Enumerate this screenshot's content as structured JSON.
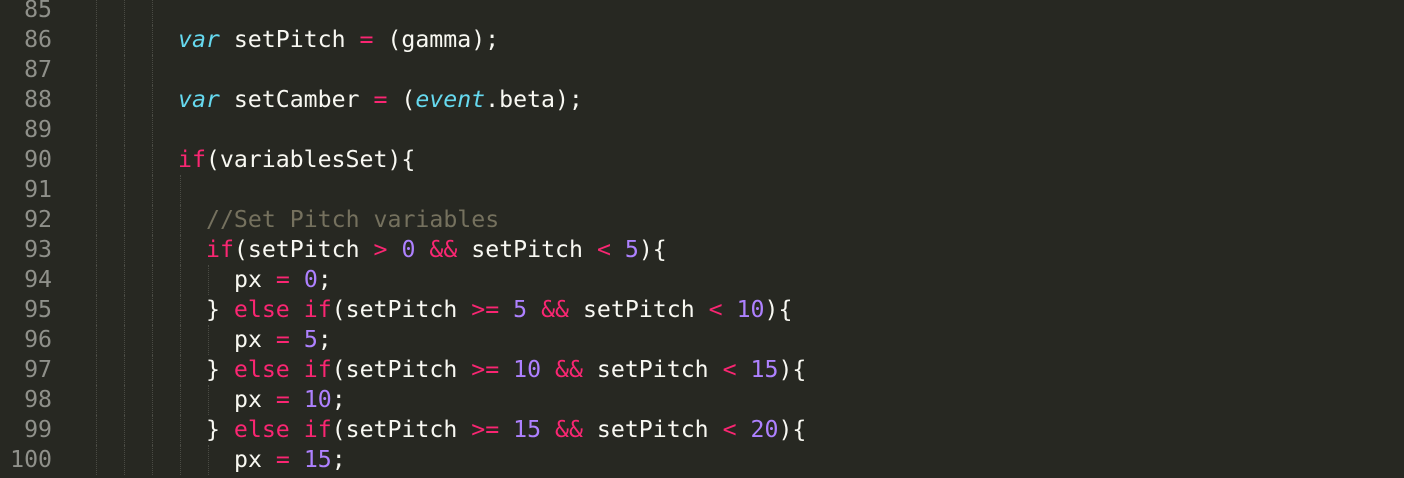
{
  "editor": {
    "theme_colors": {
      "background": "#272822",
      "keyword": "#f92672",
      "number": "#ae81ff",
      "storage": "#66d9ef",
      "comment": "#75715e",
      "text": "#f8f8f2",
      "gutter": "#8f908a"
    },
    "lines": [
      {
        "n": "85",
        "indent": 0,
        "tokens": []
      },
      {
        "n": "86",
        "indent": 0,
        "tokens": [
          [
            "storage",
            "var"
          ],
          [
            "plain",
            " setPitch "
          ],
          [
            "op",
            "="
          ],
          [
            "plain",
            " (gamma);"
          ]
        ]
      },
      {
        "n": "87",
        "indent": 0,
        "tokens": []
      },
      {
        "n": "88",
        "indent": 0,
        "tokens": [
          [
            "storage",
            "var"
          ],
          [
            "plain",
            " setCamber "
          ],
          [
            "op",
            "="
          ],
          [
            "plain",
            " ("
          ],
          [
            "storage",
            "event"
          ],
          [
            "plain",
            ".beta);"
          ]
        ]
      },
      {
        "n": "89",
        "indent": 0,
        "tokens": []
      },
      {
        "n": "90",
        "indent": 0,
        "tokens": [
          [
            "kw",
            "if"
          ],
          [
            "plain",
            "(variablesSet){"
          ]
        ]
      },
      {
        "n": "91",
        "indent": 1,
        "tokens": []
      },
      {
        "n": "92",
        "indent": 1,
        "tokens": [
          [
            "comment",
            "//Set Pitch variables"
          ]
        ]
      },
      {
        "n": "93",
        "indent": 1,
        "tokens": [
          [
            "kw",
            "if"
          ],
          [
            "plain",
            "(setPitch "
          ],
          [
            "op",
            ">"
          ],
          [
            "plain",
            " "
          ],
          [
            "num",
            "0"
          ],
          [
            "plain",
            " "
          ],
          [
            "op",
            "&&"
          ],
          [
            "plain",
            " setPitch "
          ],
          [
            "op",
            "<"
          ],
          [
            "plain",
            " "
          ],
          [
            "num",
            "5"
          ],
          [
            "plain",
            "){"
          ]
        ]
      },
      {
        "n": "94",
        "indent": 2,
        "tokens": [
          [
            "plain",
            "px "
          ],
          [
            "op",
            "="
          ],
          [
            "plain",
            " "
          ],
          [
            "num",
            "0"
          ],
          [
            "plain",
            ";"
          ]
        ]
      },
      {
        "n": "95",
        "indent": 1,
        "tokens": [
          [
            "plain",
            "} "
          ],
          [
            "kw",
            "else"
          ],
          [
            "plain",
            " "
          ],
          [
            "kw",
            "if"
          ],
          [
            "plain",
            "(setPitch "
          ],
          [
            "op",
            ">="
          ],
          [
            "plain",
            " "
          ],
          [
            "num",
            "5"
          ],
          [
            "plain",
            " "
          ],
          [
            "op",
            "&&"
          ],
          [
            "plain",
            " setPitch "
          ],
          [
            "op",
            "<"
          ],
          [
            "plain",
            " "
          ],
          [
            "num",
            "10"
          ],
          [
            "plain",
            "){"
          ]
        ]
      },
      {
        "n": "96",
        "indent": 2,
        "tokens": [
          [
            "plain",
            "px "
          ],
          [
            "op",
            "="
          ],
          [
            "plain",
            " "
          ],
          [
            "num",
            "5"
          ],
          [
            "plain",
            ";"
          ]
        ]
      },
      {
        "n": "97",
        "indent": 1,
        "tokens": [
          [
            "plain",
            "} "
          ],
          [
            "kw",
            "else"
          ],
          [
            "plain",
            " "
          ],
          [
            "kw",
            "if"
          ],
          [
            "plain",
            "(setPitch "
          ],
          [
            "op",
            ">="
          ],
          [
            "plain",
            " "
          ],
          [
            "num",
            "10"
          ],
          [
            "plain",
            " "
          ],
          [
            "op",
            "&&"
          ],
          [
            "plain",
            " setPitch "
          ],
          [
            "op",
            "<"
          ],
          [
            "plain",
            " "
          ],
          [
            "num",
            "15"
          ],
          [
            "plain",
            "){"
          ]
        ]
      },
      {
        "n": "98",
        "indent": 2,
        "tokens": [
          [
            "plain",
            "px "
          ],
          [
            "op",
            "="
          ],
          [
            "plain",
            " "
          ],
          [
            "num",
            "10"
          ],
          [
            "plain",
            ";"
          ]
        ]
      },
      {
        "n": "99",
        "indent": 1,
        "tokens": [
          [
            "plain",
            "} "
          ],
          [
            "kw",
            "else"
          ],
          [
            "plain",
            " "
          ],
          [
            "kw",
            "if"
          ],
          [
            "plain",
            "(setPitch "
          ],
          [
            "op",
            ">="
          ],
          [
            "plain",
            " "
          ],
          [
            "num",
            "15"
          ],
          [
            "plain",
            " "
          ],
          [
            "op",
            "&&"
          ],
          [
            "plain",
            " setPitch "
          ],
          [
            "op",
            "<"
          ],
          [
            "plain",
            " "
          ],
          [
            "num",
            "20"
          ],
          [
            "plain",
            "){"
          ]
        ]
      },
      {
        "n": "100",
        "indent": 2,
        "tokens": [
          [
            "plain",
            "px "
          ],
          [
            "op",
            "="
          ],
          [
            "plain",
            " "
          ],
          [
            "num",
            "15"
          ],
          [
            "plain",
            ";"
          ]
        ]
      }
    ]
  }
}
